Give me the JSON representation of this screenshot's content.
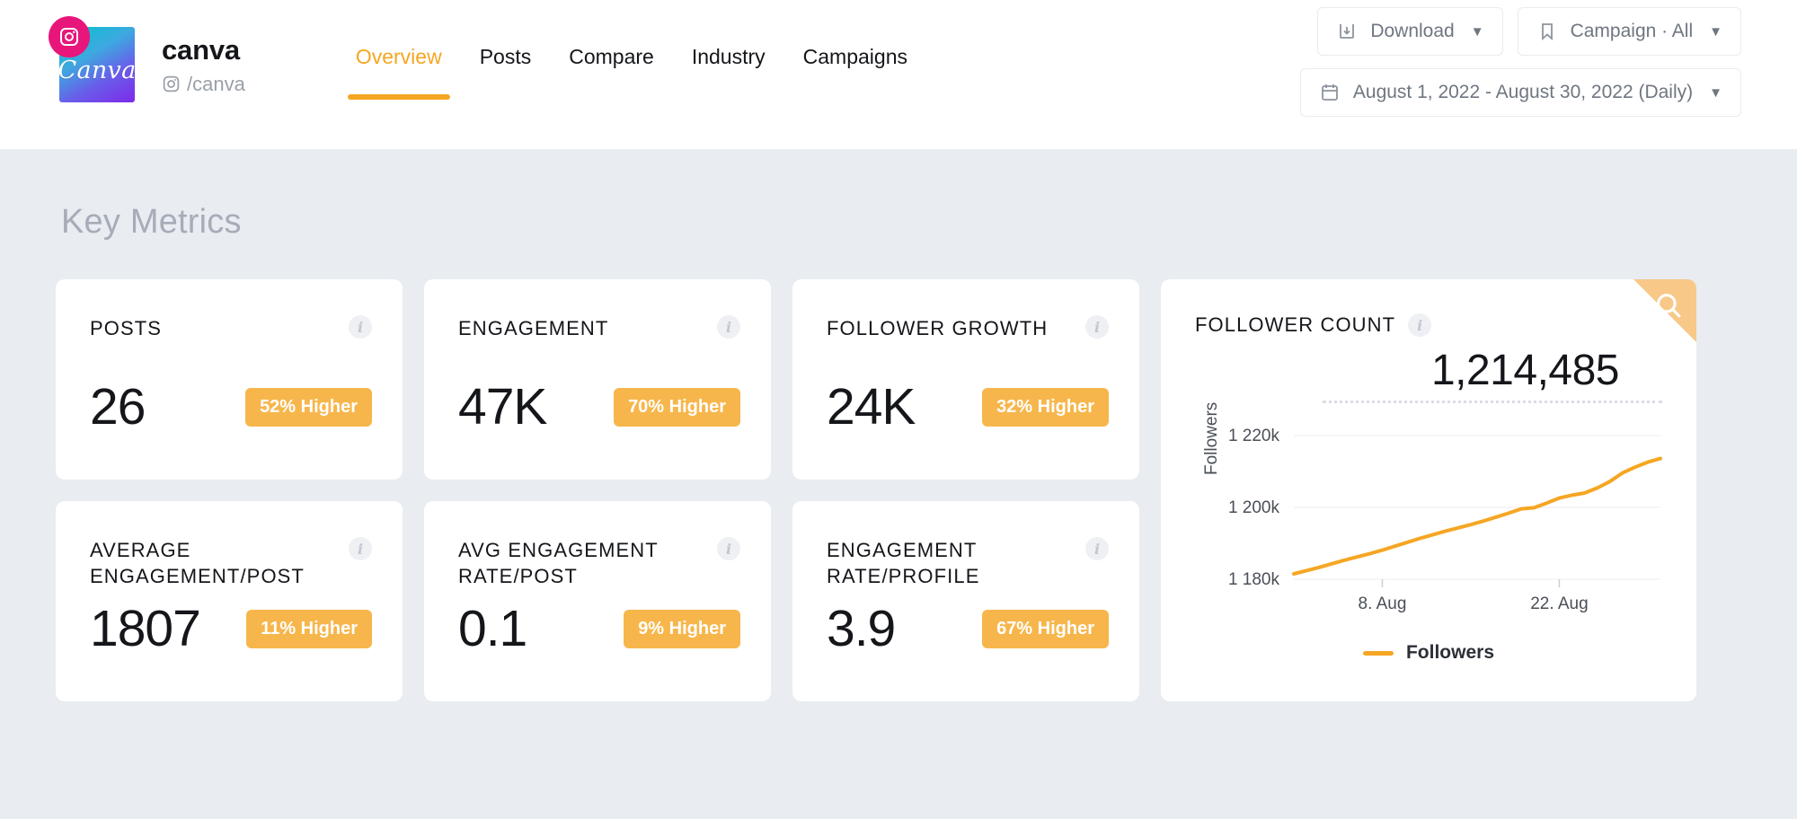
{
  "header": {
    "brand_name": "canva",
    "brand_handle": "/canva",
    "logo_text": "Canva",
    "instagram_icon": "instagram-icon",
    "tabs": [
      {
        "label": "Overview",
        "active": true
      },
      {
        "label": "Posts",
        "active": false
      },
      {
        "label": "Compare",
        "active": false
      },
      {
        "label": "Industry",
        "active": false
      },
      {
        "label": "Campaigns",
        "active": false
      }
    ],
    "controls": {
      "download_label": "Download",
      "download_icon": "download-icon",
      "campaign_label": "Campaign · All",
      "campaign_icon": "bookmark-icon",
      "date_label": "August 1, 2022 - August 30, 2022 (Daily)",
      "date_icon": "calendar-icon",
      "caret": "▼"
    }
  },
  "main": {
    "section_title": "Key Metrics",
    "cards": [
      {
        "label": "POSTS",
        "value": "26",
        "badge": "52% Higher"
      },
      {
        "label": "ENGAGEMENT",
        "value": "47K",
        "badge": "70% Higher"
      },
      {
        "label": "FOLLOWER GROWTH",
        "value": "24K",
        "badge": "32% Higher"
      },
      {
        "label": "AVERAGE ENGAGEMENT/POST",
        "value": "1807",
        "badge": "11% Higher"
      },
      {
        "label": "AVG ENGAGEMENT RATE/POST",
        "value": "0.1",
        "badge": "9% Higher"
      },
      {
        "label": "ENGAGEMENT RATE/PROFILE",
        "value": "3.9",
        "badge": "67% Higher"
      }
    ],
    "chart_card": {
      "label": "FOLLOWER COUNT",
      "value": "1,214,485",
      "search_icon": "search-icon",
      "info_icon": "info-icon"
    }
  },
  "colors": {
    "accent": "#f5a623",
    "badge": "#f7b64b",
    "corner": "#f7c887",
    "page_bg": "#e9ecf1"
  },
  "chart_data": {
    "type": "line",
    "title": "FOLLOWER COUNT",
    "xlabel": "",
    "ylabel": "Followers",
    "legend": [
      "Followers"
    ],
    "legend_position": "bottom",
    "grid": true,
    "ylim": [
      1180000,
      1220000
    ],
    "ytick_labels": [
      "1 220k",
      "1 200k",
      "1 180k"
    ],
    "yticks": [
      1220000,
      1200000,
      1180000
    ],
    "xtick_labels": [
      "8. Aug",
      "22. Aug"
    ],
    "xticks": [
      8,
      22
    ],
    "x": [
      1,
      2,
      3,
      4,
      5,
      6,
      7,
      8,
      9,
      10,
      11,
      12,
      13,
      14,
      15,
      16,
      17,
      18,
      19,
      20,
      21,
      22,
      23,
      24,
      25,
      26,
      27,
      28,
      29,
      30
    ],
    "series": [
      {
        "name": "Followers",
        "color": "#f5a623",
        "values": [
          1181500,
          1182400,
          1183300,
          1184300,
          1185300,
          1186200,
          1187100,
          1188100,
          1189200,
          1190300,
          1191400,
          1192400,
          1193400,
          1194300,
          1195200,
          1196200,
          1197300,
          1198400,
          1199600,
          1199900,
          1201200,
          1202600,
          1203400,
          1204000,
          1205400,
          1207200,
          1209600,
          1211200,
          1212600,
          1213600
        ]
      }
    ]
  }
}
